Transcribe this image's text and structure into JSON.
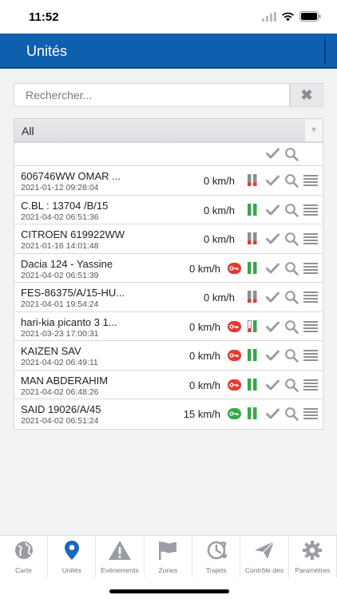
{
  "status_bar": {
    "time": "11:52"
  },
  "header": {
    "title": "Unités"
  },
  "search": {
    "placeholder": "Rechercher..."
  },
  "filter": {
    "selected": "All"
  },
  "units": [
    {
      "name": "606746WW OMAR ...",
      "date": "2021-01-12 09:28:04",
      "speed": "0 km/h",
      "key": "",
      "battery": "low"
    },
    {
      "name": "C.BL : 13704 /B/15",
      "date": "2021-04-02 06:51:36",
      "speed": "0 km/h",
      "key": "",
      "battery": "full"
    },
    {
      "name": "CITROEN 619922WW",
      "date": "2021-01-16 14:01:48",
      "speed": "0 km/h",
      "key": "",
      "battery": "low"
    },
    {
      "name": "Dacia 124 - Yassine",
      "date": "2021-04-02 06:51:39",
      "speed": "0 km/h",
      "key": "red",
      "battery": "full"
    },
    {
      "name": "FES-86375/A/15-HU...",
      "date": "2021-04-01 19:54:24",
      "speed": "0 km/h",
      "key": "",
      "battery": "low"
    },
    {
      "name": "hari-kia picanto 3 1...",
      "date": "2021-03-23 17:00:31",
      "speed": "0 km/h",
      "key": "red",
      "battery": "half"
    },
    {
      "name": "KAIZEN SAV",
      "date": "2021-04-02 06:49:11",
      "speed": "0 km/h",
      "key": "red",
      "battery": "full"
    },
    {
      "name": "MAN ABDERAHIM",
      "date": "2021-04-02 06:48:26",
      "speed": "0 km/h",
      "key": "red",
      "battery": "full"
    },
    {
      "name": "SAID 19026/A/45",
      "date": "2021-04-02 06:51:24",
      "speed": "15 km/h",
      "key": "green",
      "battery": "full"
    }
  ],
  "tabs": [
    {
      "label": "Carte",
      "icon": "globe-icon",
      "active": false
    },
    {
      "label": "Unités",
      "icon": "location-pin-icon",
      "active": true
    },
    {
      "label": "Evénements",
      "icon": "warning-icon",
      "active": false
    },
    {
      "label": "Zones",
      "icon": "flag-icon",
      "active": false
    },
    {
      "label": "Trajets",
      "icon": "route-clock-icon",
      "active": false
    },
    {
      "label": "Contrôle des",
      "icon": "paper-plane-icon",
      "active": false
    },
    {
      "label": "Paramètres",
      "icon": "gear-icon",
      "active": false
    }
  ],
  "colors": {
    "header": "#0e5fae",
    "active_tab": "#1a66b8",
    "key_red": "#e53b2f",
    "key_green": "#35a84a",
    "battery_green": "#35a84a",
    "battery_red": "#e53b2f"
  }
}
